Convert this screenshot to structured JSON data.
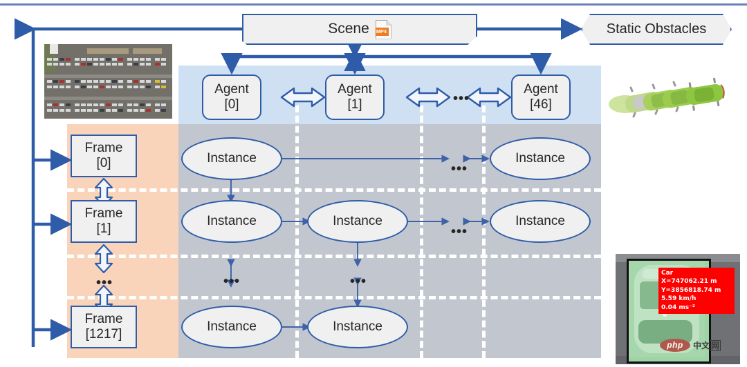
{
  "diagram": {
    "title": "Scene / Agent / Frame / Instance data structure",
    "colors": {
      "accent_blue": "#2E5CA8",
      "top_rule": "#6682B9",
      "agent_band": "#CFE0F2",
      "instance_band": "#C2C6CF",
      "frame_band": "#F9D4BA",
      "node_fill": "#F0F0F0",
      "label_red": "#FE0000"
    }
  },
  "scene": {
    "label": "Scene",
    "file_icon": "mp4-file-icon",
    "file_icon_text": "MP4"
  },
  "static_obstacles": {
    "label": "Static Obstacles"
  },
  "agents": {
    "band_name": "agent-band",
    "items": [
      {
        "label_top": "Agent",
        "label_bottom": "[0]"
      },
      {
        "label_top": "Agent",
        "label_bottom": "[1]"
      },
      {
        "label_top": "Agent",
        "label_bottom": "[46]"
      }
    ],
    "ellipsis": "•••"
  },
  "frames": {
    "band_name": "frame-band",
    "items": [
      {
        "label_top": "Frame",
        "label_bottom": "[0]"
      },
      {
        "label_top": "Frame",
        "label_bottom": "[1]"
      },
      {
        "label_top": "Frame",
        "label_bottom": "[1217]"
      }
    ],
    "ellipsis": "•••"
  },
  "instances": {
    "band_name": "instance-band",
    "label": "Instance",
    "ellipsis": "•••",
    "rows": [
      {
        "row_name": "instance-row-0",
        "cells": [
          "Instance",
          "",
          "Instance"
        ]
      },
      {
        "row_name": "instance-row-1",
        "cells": [
          "Instance",
          "Instance",
          "Instance"
        ]
      },
      {
        "row_name": "instance-row-last",
        "cells": [
          "Instance",
          "Instance",
          ""
        ]
      }
    ]
  },
  "imagery": {
    "aerial": {
      "name": "aerial-parking-lot-image",
      "alt": "Aerial view of parking lot"
    },
    "trajectory": {
      "name": "green-car-trajectory-image",
      "alt": "Overlapping green car silhouettes showing trajectory"
    },
    "detection": {
      "name": "car-detection-image",
      "alt": "Top-down detected car with bounding box",
      "label_lines": [
        "Car",
        "X=747062.21 m",
        "Y=3856818.74 m",
        "5.59 km/h",
        "0.04 ms⁻²"
      ],
      "watermark": {
        "pill": "php",
        "text": "中文",
        "boxed": "网"
      }
    }
  }
}
